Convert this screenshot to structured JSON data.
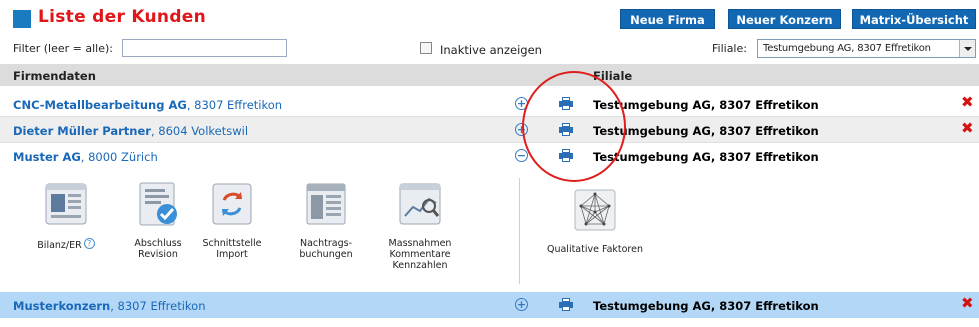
{
  "header": {
    "title": "Liste der Kunden",
    "buttons": {
      "neue_firma": "Neue Firma",
      "neuer_konzern": "Neuer Konzern",
      "matrix": "Matrix-Übersicht"
    }
  },
  "filter": {
    "label": "Filter (leer = alle):",
    "value": "",
    "inactive_label": "Inaktive anzeigen",
    "inactive_checked": false,
    "filiale_label": "Filiale:",
    "filiale_value": "Testumgebung AG, 8307 Effretikon"
  },
  "table": {
    "col_firmendaten": "Firmendaten",
    "col_filiale": "Filiale",
    "rows": [
      {
        "name": "CNC-Metallbearbeitung AG",
        "loc": ", 8307 Effretikon",
        "filiale": "Testumgebung AG, 8307 Effretikon",
        "expander": "+",
        "deletable": true
      },
      {
        "name": "Dieter Müller Partner",
        "loc": ", 8604 Volketswil",
        "filiale": "Testumgebung AG, 8307 Effretikon",
        "expander": "+",
        "deletable": true
      },
      {
        "name": "Muster AG",
        "loc": ", 8000 Zürich",
        "filiale": "Testumgebung AG, 8307 Effretikon",
        "expander": "−",
        "deletable": false
      },
      {
        "name": "Musterkonzern",
        "loc": ", 8307 Effretikon",
        "filiale": "Testumgebung AG, 8307 Effretikon",
        "expander": "+",
        "deletable": true
      }
    ]
  },
  "panel": {
    "tools": [
      {
        "label": "Bilanz/ER",
        "icon": "balance-sheet-icon"
      },
      {
        "label": "Abschluss\nRevision",
        "icon": "revision-check-icon"
      },
      {
        "label": "Schnittstelle\nImport",
        "icon": "import-sync-icon"
      },
      {
        "label": "Nachtrags-\nbuchungen",
        "icon": "bookings-icon"
      },
      {
        "label": "Massnahmen\nKommentare\nKennzahlen",
        "icon": "measures-chart-icon"
      }
    ],
    "qualitative": {
      "label": "Qualitative Faktoren",
      "icon": "network-graph-icon"
    }
  },
  "colors": {
    "title_red": "#e0161b",
    "button_blue": "#1268b3",
    "link_blue": "#1a68b8",
    "highlight_row": "#b3d8f7",
    "delete_red": "#d41414"
  }
}
